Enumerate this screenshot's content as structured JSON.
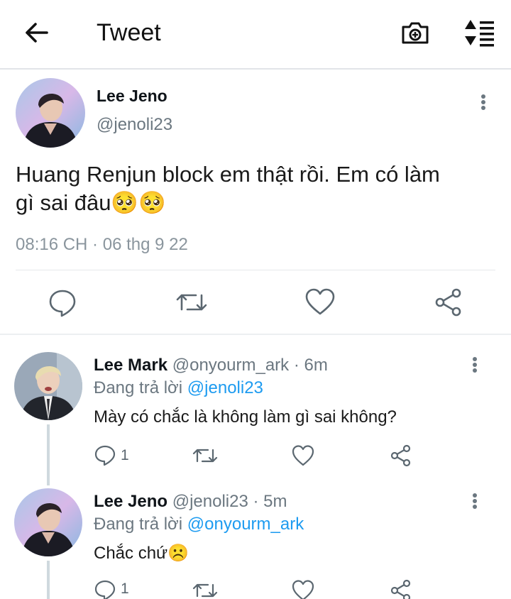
{
  "header": {
    "title": "Tweet",
    "icons": {
      "back": "back-arrow-icon",
      "camera": "camera-icon",
      "sort": "sort-icon"
    }
  },
  "main_tweet": {
    "author_name": "Lee Jeno",
    "handle": "@jenoli23",
    "text_line1": "Huang Renjun block em thật rồi. Em có làm",
    "text_line2": "gì sai đâu🥺🥺",
    "timestamp": "08:16 CH · 06 thg 9 22"
  },
  "replies": [
    {
      "author_name": "Lee Mark",
      "meta": "@onyourm_ark · 6m",
      "replying_prefix": "Đang trả lời",
      "replying_to": "@jenoli23",
      "text": "Mày có chắc là không làm gì sai không?",
      "reply_count": "1"
    },
    {
      "author_name": "Lee Jeno",
      "meta": "@jenoli23 · 5m",
      "replying_prefix": "Đang trả lời",
      "replying_to": "@onyourm_ark",
      "text": "Chắc chứ☹️",
      "reply_count": "1"
    }
  ],
  "colors": {
    "accent": "#1d9bf0",
    "icon_gray": "#5b6770",
    "text": "#0f1419"
  }
}
